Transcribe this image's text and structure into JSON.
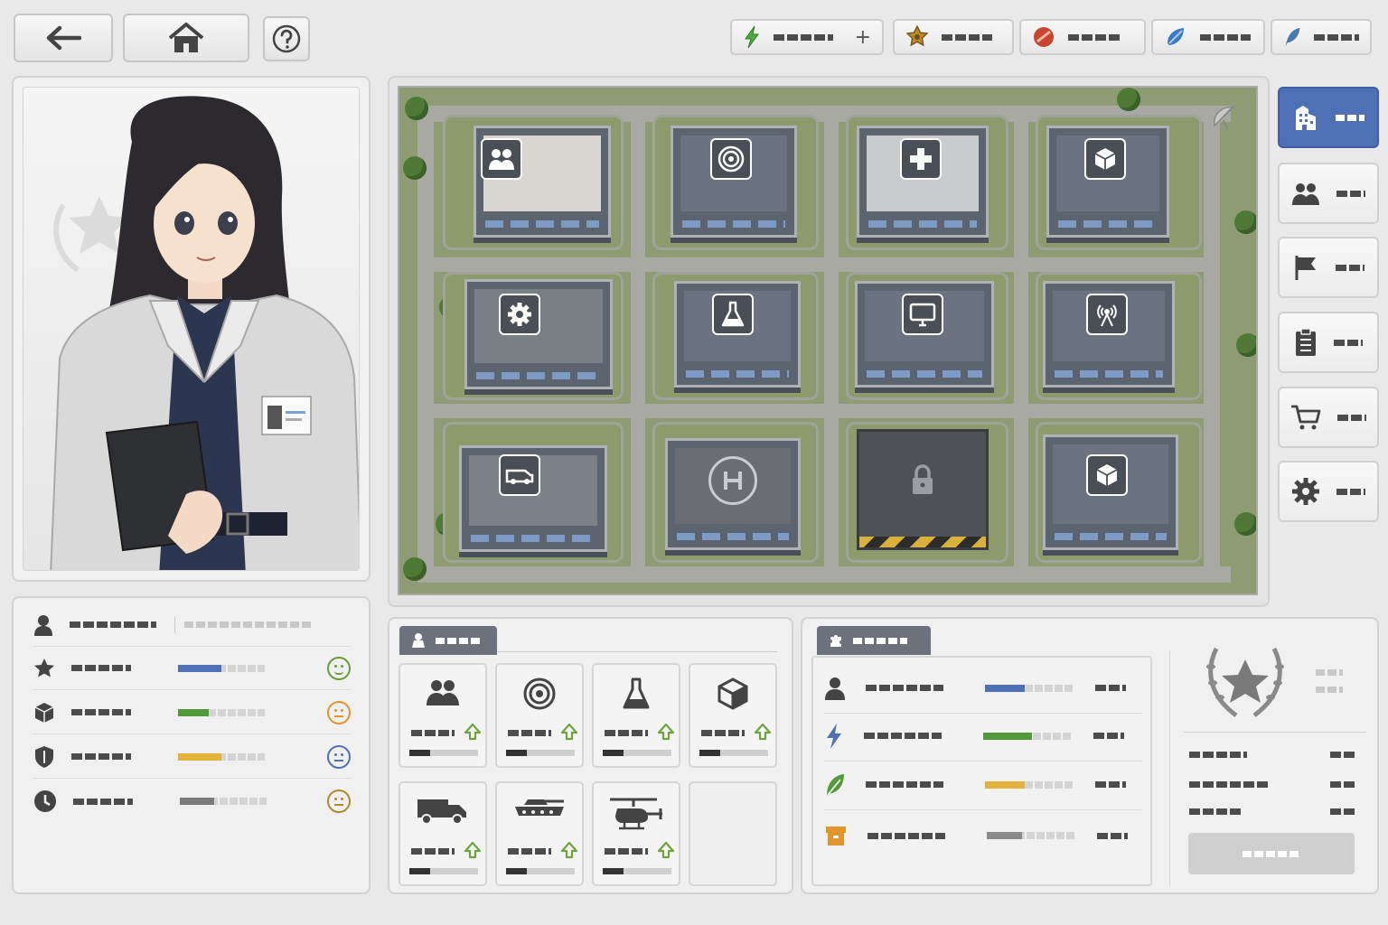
{
  "top_bar": {
    "nav_buttons": [
      {
        "name": "back-button",
        "icon": "arrow-left-icon"
      },
      {
        "name": "home-button",
        "icon": "home-icon"
      },
      {
        "name": "help-button",
        "icon": "question-circle-icon"
      }
    ],
    "resources": [
      {
        "name": "energy",
        "icon": "lightning-icon",
        "color": "#4caf3c",
        "has_add_button": true
      },
      {
        "name": "badge",
        "icon": "gold-star-badge-icon",
        "color": "#b88a2a"
      },
      {
        "name": "red-resource",
        "icon": "red-gem-icon",
        "color": "#c8452f"
      },
      {
        "name": "blue-resource",
        "icon": "blue-gem-icon",
        "color": "#3b78c4"
      },
      {
        "name": "feather-resource",
        "icon": "blue-feather-icon",
        "color": "#4b79ad"
      }
    ]
  },
  "character": {
    "portrait_icon": "researcher-portrait",
    "emblem_icon": "laurel-star-emblem-icon",
    "stats": [
      {
        "icon": "person-icon",
        "bar_value": null,
        "mood": null
      },
      {
        "icon": "star-icon",
        "bar_value": 0.5,
        "bar_color": "#4f70b5",
        "mood": "happy",
        "mood_color": "#6a9a3a"
      },
      {
        "icon": "cube-icon",
        "bar_value": 0.35,
        "bar_color": "#52993a",
        "mood": "neutral",
        "mood_color": "#e0962a"
      },
      {
        "icon": "shield-icon",
        "bar_value": 0.5,
        "bar_color": "#e3b23c",
        "mood": "neutral",
        "mood_color": "#4f70b5"
      },
      {
        "icon": "clock-icon",
        "bar_value": 0.4,
        "bar_color": "#7a7a7a",
        "mood": "neutral",
        "mood_color": "#b08a2a"
      }
    ]
  },
  "map": {
    "buildings": [
      {
        "name": "barracks",
        "icon": "people-icon"
      },
      {
        "name": "training",
        "icon": "target-icon"
      },
      {
        "name": "medical",
        "icon": "medical-cross-icon"
      },
      {
        "name": "storage",
        "icon": "cube-icon"
      },
      {
        "name": "workshop",
        "icon": "gear-icon"
      },
      {
        "name": "laboratory",
        "icon": "flask-icon"
      },
      {
        "name": "command",
        "icon": "monitor-icon"
      },
      {
        "name": "communications",
        "icon": "antenna-icon"
      },
      {
        "name": "garage",
        "icon": "vehicle-icon"
      },
      {
        "name": "helipad",
        "icon": "helipad-icon"
      },
      {
        "name": "locked-plot",
        "icon": "lock-icon"
      },
      {
        "name": "warehouse",
        "icon": "cube-icon"
      }
    ]
  },
  "side_nav": [
    {
      "name": "base",
      "icon": "building-icon",
      "active": true
    },
    {
      "name": "personnel",
      "icon": "people-icon",
      "active": false
    },
    {
      "name": "missions",
      "icon": "flag-icon",
      "active": false
    },
    {
      "name": "tasks",
      "icon": "clipboard-icon",
      "active": false
    },
    {
      "name": "shop",
      "icon": "cart-icon",
      "active": false
    },
    {
      "name": "settings",
      "icon": "gear-icon",
      "active": false
    }
  ],
  "facilities": {
    "tab_icon": "facility-icon",
    "cards": [
      {
        "icon": "people-icon",
        "progress": 0.3
      },
      {
        "icon": "target-icon",
        "progress": 0.3
      },
      {
        "icon": "flask-icon",
        "progress": 0.3
      },
      {
        "icon": "cube-icon",
        "progress": 0.3
      },
      {
        "icon": "truck-icon",
        "progress": 0.3
      },
      {
        "icon": "tank-icon",
        "progress": 0.3
      },
      {
        "icon": "helicopter-icon",
        "progress": 0.3
      }
    ]
  },
  "production": {
    "tab_icon": "puzzle-icon",
    "rows": [
      {
        "icon": "person-icon",
        "bar_value": 0.45,
        "bar_color": "#4f70b5"
      },
      {
        "icon": "lightning-icon",
        "bar_value": 0.55,
        "bar_color": "#52993a"
      },
      {
        "icon": "leaf-icon",
        "bar_value": 0.45,
        "bar_color": "#e3b23c"
      },
      {
        "icon": "box-icon",
        "bar_value": 0.4,
        "bar_color": "#8a8a8a"
      }
    ]
  },
  "rank": {
    "emblem_icon": "laurel-star-emblem-icon",
    "action_button": {
      "enabled": false
    }
  }
}
